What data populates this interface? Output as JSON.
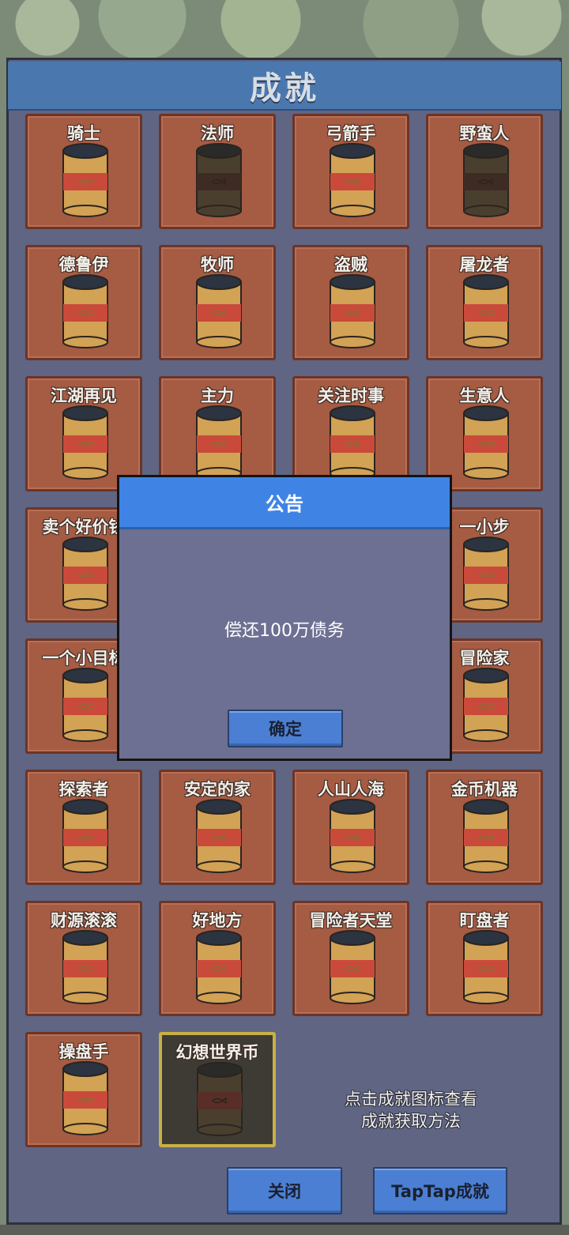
{
  "panel": {
    "title": "成就"
  },
  "achievements": [
    {
      "label": "骑士",
      "can": "normal"
    },
    {
      "label": "法师",
      "can": "dark"
    },
    {
      "label": "弓箭手",
      "can": "normal"
    },
    {
      "label": "野蛮人",
      "can": "dark"
    },
    {
      "label": "德鲁伊",
      "can": "normal"
    },
    {
      "label": "牧师",
      "can": "normal"
    },
    {
      "label": "盗贼",
      "can": "normal"
    },
    {
      "label": "屠龙者",
      "can": "normal"
    },
    {
      "label": "江湖再见",
      "can": "normal"
    },
    {
      "label": "主力",
      "can": "normal"
    },
    {
      "label": "关注时事",
      "can": "normal"
    },
    {
      "label": "生意人",
      "can": "normal"
    },
    {
      "label": "卖个好价钱",
      "can": "normal"
    },
    {
      "label": "",
      "can": "normal"
    },
    {
      "label": "",
      "can": "normal"
    },
    {
      "label": "一小步",
      "can": "normal"
    },
    {
      "label": "一个小目标",
      "can": "normal"
    },
    {
      "label": "",
      "can": "normal"
    },
    {
      "label": "",
      "can": "normal"
    },
    {
      "label": "冒险家",
      "can": "normal"
    },
    {
      "label": "探索者",
      "can": "normal"
    },
    {
      "label": "安定的家",
      "can": "normal"
    },
    {
      "label": "人山人海",
      "can": "normal"
    },
    {
      "label": "金币机器",
      "can": "normal"
    },
    {
      "label": "财源滚滚",
      "can": "normal"
    },
    {
      "label": "好地方",
      "can": "normal"
    },
    {
      "label": "冒险者天堂",
      "can": "normal"
    },
    {
      "label": "盯盘者",
      "can": "normal"
    },
    {
      "label": "操盘手",
      "can": "normal"
    },
    {
      "label": "幻想世界币",
      "can": "locked"
    }
  ],
  "hint": {
    "line1": "点击成就图标查看",
    "line2": "成就获取方法"
  },
  "buttons": {
    "close": "关闭",
    "taptap": "TapTap成就"
  },
  "modal": {
    "title": "公告",
    "message": "偿还100万债务",
    "confirm": "确定"
  },
  "colors": {
    "accent": "#3f84e5",
    "card": "#a65b43",
    "panel": "#5f6583"
  }
}
